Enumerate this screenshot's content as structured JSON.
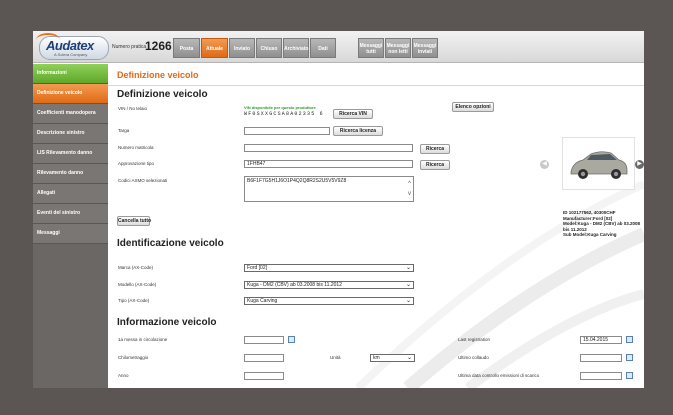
{
  "topbar": {
    "logo": "Audatex",
    "logo_sub": "A Solera Company",
    "pratica_label": "Numero pratica",
    "pratica_number": "1266",
    "tabs": [
      {
        "label": "Posta"
      },
      {
        "label": "Attuale"
      },
      {
        "label": "Inviato"
      },
      {
        "label": "Chiuso"
      },
      {
        "label": "Archiviato"
      },
      {
        "label": "Dati storici"
      },
      {
        "label": "Messaggi tutti",
        "line1": "Messaggi",
        "line2": "tutti"
      },
      {
        "label": "Messaggi non letti",
        "line1": "Messaggi",
        "line2": "non letti"
      },
      {
        "label": "Messaggi inviati",
        "line1": "Messaggi",
        "line2": "inviati"
      }
    ]
  },
  "sidebar": {
    "items": [
      {
        "label": "Informazioni"
      },
      {
        "label": "Definizione veicolo"
      },
      {
        "label": "Coefficienti manodopera"
      },
      {
        "label": "Descrizione sinistro"
      },
      {
        "label": "LIS Rilevamento danno"
      },
      {
        "label": "Rilevamento danno"
      },
      {
        "label": "Allegati"
      },
      {
        "label": "Eventi del sinistro"
      },
      {
        "label": "Messaggi"
      }
    ]
  },
  "page": {
    "header": "Definizione veicolo",
    "section1_title": "Definizione veicolo",
    "vin_label": "VIN / No telaio",
    "vin_note": "VIN disponibile per questo produttore",
    "vin_value": "WF0SXXGCSA8A02335 6",
    "vin_button": "Ricerca VIN",
    "options_button": "Elenco opzioni",
    "targa_label": "Targa",
    "targa_value": "",
    "license_button": "Ricerca licenza",
    "matricola_label": "Numero matricola",
    "matricola_value": "",
    "ricerca_button": "Ricerca",
    "approval_label": "Approvazione tipo",
    "approval_value": "1FHB47",
    "ricerca2_button": "Ricerca",
    "axmo_label": "Codici AXMO selezionati",
    "axmo_value": "B6F1F7G5H1J6O1P4Q2Q8R2S2U5V5V9Z8",
    "clear_button": "Cancella tutto",
    "car_info": {
      "line1": "ID 102177562, 40300CHF",
      "line2": "Manufacturer:Ford [02]",
      "line3": "Model:Kuga - DM2 (CBV) ab 03.2008 bis 11.2012",
      "line4": "Sub Model:Kuga Carving"
    },
    "section2_title": "Identificazione veicolo",
    "marca_label": "Marca (AX-Code)",
    "marca_value": "Ford [02]",
    "modello_label": "Modello (AX-Code)",
    "modello_value": "Kuga - DM2 (CBV) ab 03.2008 bis 11.2012",
    "tipo_label": "Tipo (AX-Code)",
    "tipo_value": "Kuga Carving",
    "section3_title": "Informazione veicolo",
    "circolazione_label": "1a messa in circolazione",
    "circolazione_value": "",
    "km_label": "Chilometraggio",
    "km_value": "",
    "unita_label": "Unità",
    "unita_value": "km",
    "anno_label": "Anno",
    "anno_value": "",
    "last_reg_label": "Last registration",
    "last_reg_value": "15.04.2015",
    "collaudo_label": "Ultimo collaudo",
    "collaudo_value": "",
    "emissioni_label": "Ultima data controllo emissioni di scarico",
    "emissioni_value": ""
  },
  "colors": {
    "accent_orange": "#e06a15",
    "active_green": "#6fba35",
    "sidebar_gray": "#7a7674",
    "background": "#5b5653"
  },
  "icons": {
    "calendar": "calendar-icon",
    "prev": "chevron-left-icon",
    "next": "chevron-right-icon",
    "dropdown": "chevron-down-icon"
  }
}
